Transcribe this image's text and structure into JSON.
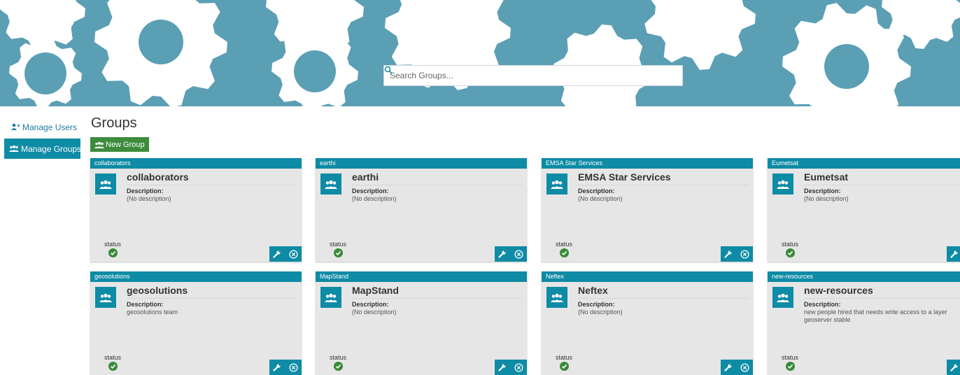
{
  "search": {
    "placeholder": "Search Groups..."
  },
  "sidebar": {
    "manage_users": "Manage Users",
    "manage_groups": "Manage Groups"
  },
  "main": {
    "title": "Groups",
    "new_group_label": "New Group"
  },
  "labels": {
    "description": "Description:",
    "status": "status"
  },
  "colors": {
    "banner": "#5b9fb5",
    "accent": "#0e8ba5",
    "new_group_button": "#3c8c3c",
    "status_enabled": "#3a8a3a"
  },
  "groups": [
    {
      "header": "collaborators",
      "name": "collaborators",
      "description": "(No description)",
      "status": "enabled"
    },
    {
      "header": "earthi",
      "name": "earthi",
      "description": "(No description)",
      "status": "enabled"
    },
    {
      "header": "EMSA Star Services",
      "name": "EMSA Star Services",
      "description": "(No description)",
      "status": "enabled"
    },
    {
      "header": "Eumetsat",
      "name": "Eumetsat",
      "description": "(No description)",
      "status": "enabled"
    },
    {
      "header": "geosolutions",
      "name": "geosolutions",
      "description": "geosolutions team",
      "status": "enabled"
    },
    {
      "header": "MapStand",
      "name": "MapStand",
      "description": "(No description)",
      "status": "enabled"
    },
    {
      "header": "Neftex",
      "name": "Neftex",
      "description": "(No description)",
      "status": "enabled"
    },
    {
      "header": "new-resources",
      "name": "new-resources",
      "description": "new people hired that needs write access to a layer geoserver stable",
      "status": "enabled"
    }
  ]
}
